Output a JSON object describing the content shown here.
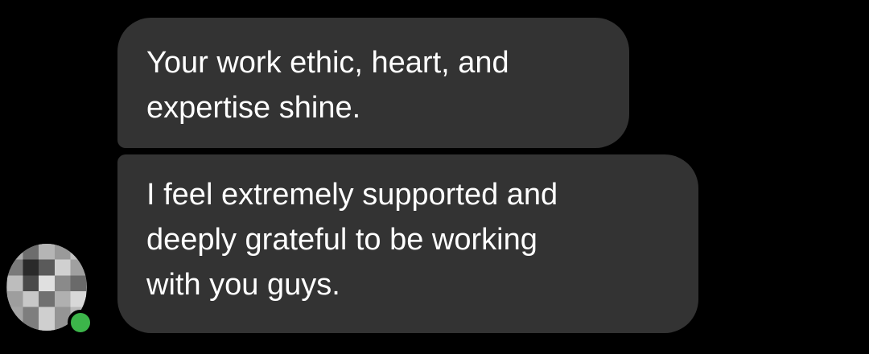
{
  "conversation": {
    "messages": [
      {
        "lines": [
          "Your work ethic, heart, and",
          "expertise shine."
        ]
      },
      {
        "lines": [
          "I feel extremely supported and",
          "deeply grateful to be working",
          "with you guys."
        ]
      }
    ],
    "sender": {
      "avatar": "pixelated-profile-photo",
      "status": "online",
      "status_color": "#3cb54a"
    }
  },
  "colors": {
    "background": "#000000",
    "bubble": "#333333",
    "text": "#ffffff"
  }
}
